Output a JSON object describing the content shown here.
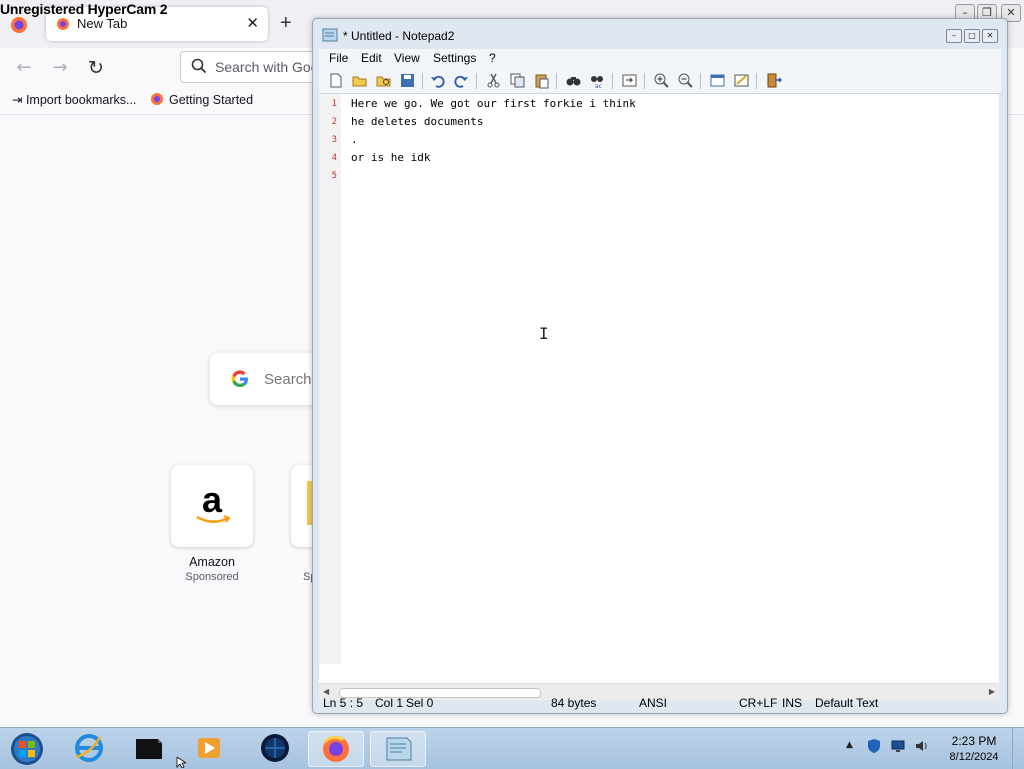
{
  "watermark": "Unregistered HyperCam 2",
  "firefox": {
    "tab": {
      "title": "New Tab",
      "close": "✕"
    },
    "new_tab_symbol": "+",
    "url_placeholder": "Search with Goo",
    "bookmarks": [
      "Import bookmarks...",
      "Getting Started"
    ],
    "google_search_placeholder": "Search",
    "shortcuts": [
      {
        "label": "Amazon",
        "sub": "Sponsored"
      },
      {
        "label": "",
        "sub": "Sp"
      }
    ]
  },
  "notepad": {
    "title": "* Untitled - Notepad2",
    "menu": [
      "File",
      "Edit",
      "View",
      "Settings",
      "?"
    ],
    "lines": [
      {
        "n": "1",
        "text": "Here we go. We got our first forkie i think"
      },
      {
        "n": "2",
        "text": "he deletes documents"
      },
      {
        "n": "3",
        "text": "."
      },
      {
        "n": "4",
        "text": "or is he idk"
      },
      {
        "n": "5",
        "text": ""
      }
    ],
    "status": {
      "position": "Ln 5 : 5",
      "col": "Col 1",
      "sel": "Sel 0",
      "size": "84 bytes",
      "encoding": "ANSI",
      "eol": "CR+LF",
      "mode": "INS",
      "scheme": "Default Text"
    }
  },
  "taskbar": {
    "items": [
      "start-orb",
      "internet-explorer",
      "terminal-app",
      "media-player",
      "app-globe",
      "firefox",
      "notepad2"
    ],
    "active_item": "notepad2",
    "time": "2:23 PM",
    "date": "8/12/2024"
  },
  "colors": {
    "line_number": "#c0392b",
    "taskbar": "#bcd4ea",
    "notepad_frame": "#dfe7f1"
  }
}
